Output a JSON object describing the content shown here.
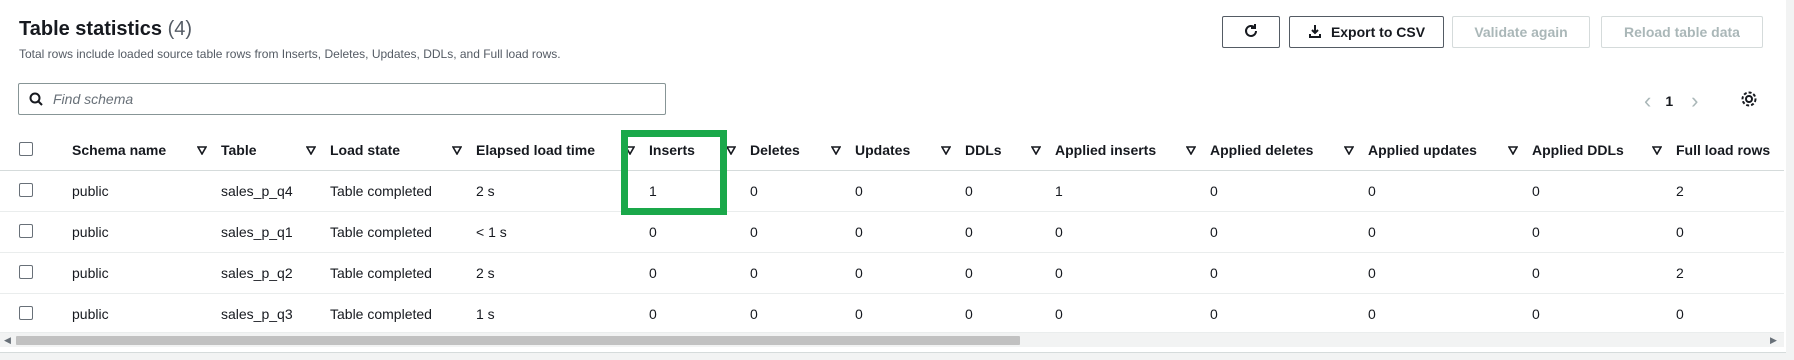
{
  "header": {
    "title": "Table statistics",
    "count": "(4)",
    "description": "Total rows include loaded source table rows from Inserts, Deletes, Updates, DDLs, and Full load rows."
  },
  "actions": {
    "refresh_icon": "refresh-icon",
    "export_label": "Export to CSV",
    "validate_label": "Validate again",
    "reload_label": "Reload table data"
  },
  "search": {
    "placeholder": "Find schema",
    "value": ""
  },
  "pagination": {
    "page": "1"
  },
  "table": {
    "columns": [
      "Schema name",
      "Table",
      "Load state",
      "Elapsed load time",
      "Inserts",
      "Deletes",
      "Updates",
      "DDLs",
      "Applied inserts",
      "Applied deletes",
      "Applied updates",
      "Applied DDLs",
      "Full load rows"
    ],
    "rows": [
      [
        "public",
        "sales_p_q4",
        "Table completed",
        "2 s",
        "1",
        "0",
        "0",
        "0",
        "1",
        "0",
        "0",
        "0",
        "2"
      ],
      [
        "public",
        "sales_p_q1",
        "Table completed",
        "< 1 s",
        "0",
        "0",
        "0",
        "0",
        "0",
        "0",
        "0",
        "0",
        "0"
      ],
      [
        "public",
        "sales_p_q2",
        "Table completed",
        "2 s",
        "0",
        "0",
        "0",
        "0",
        "0",
        "0",
        "0",
        "0",
        "2"
      ],
      [
        "public",
        "sales_p_q3",
        "Table completed",
        "1 s",
        "0",
        "0",
        "0",
        "0",
        "0",
        "0",
        "0",
        "0",
        "0"
      ]
    ]
  },
  "colors": {
    "highlight": "#1aa84a",
    "border": "#d5dbdb",
    "text": "#16191f"
  }
}
